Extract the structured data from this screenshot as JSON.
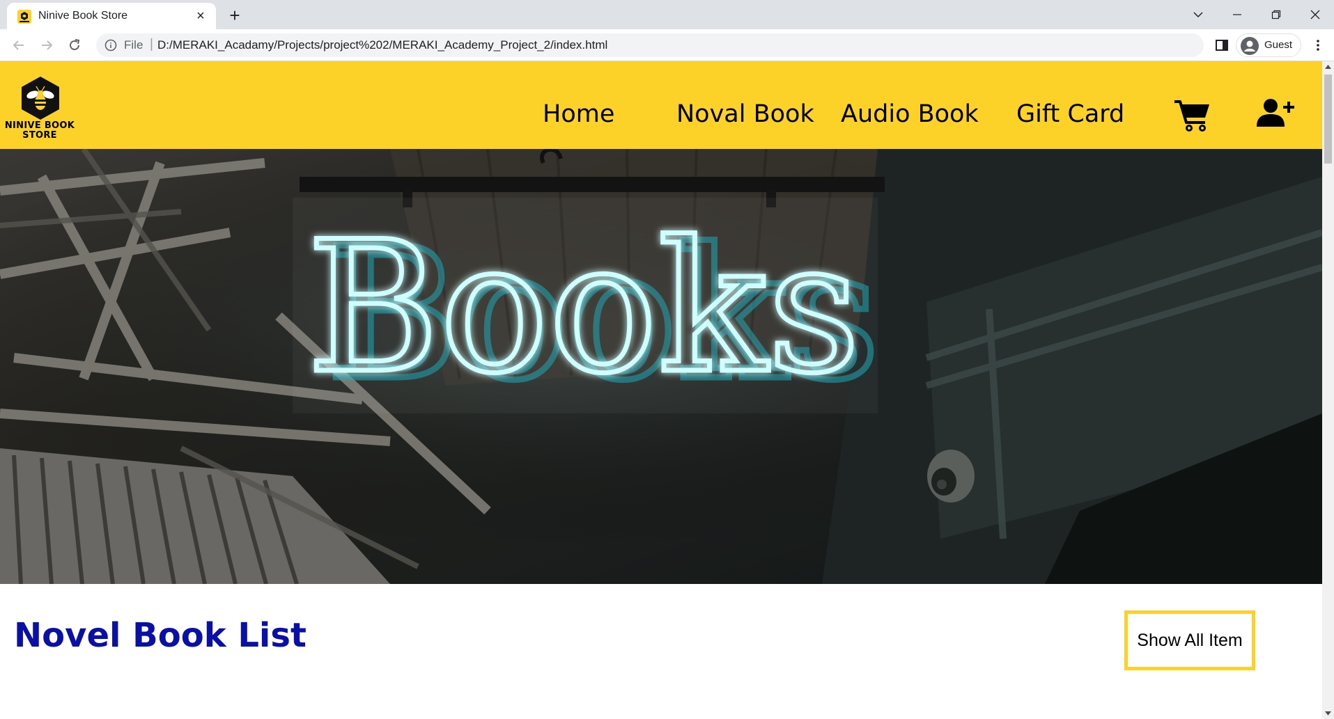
{
  "browser": {
    "tab": {
      "title": "Ninive Book Store",
      "favicon": "bee-favicon",
      "close": "×"
    },
    "new_tab": "+",
    "window_controls": [
      "tab-search",
      "minimize",
      "restore",
      "close"
    ],
    "address_bar": {
      "scheme_label": "File",
      "separator": "|",
      "url": "D:/MERAKI_Acadamy/Projects/project%202/MERAKI_Academy_Project_2/index.html"
    },
    "profile": {
      "label": "Guest"
    }
  },
  "site": {
    "brand": {
      "line1": "NINIVE BOOK",
      "line2": "STORE",
      "colors": {
        "header": "#fcd228"
      }
    },
    "nav": [
      {
        "label": "Home"
      },
      {
        "label": "Noval Book"
      },
      {
        "label": "Audio Book"
      },
      {
        "label": "Gift Card"
      }
    ],
    "icons": {
      "cart": "shopping-cart-icon",
      "account": "user-plus-icon"
    },
    "hero": {
      "sign_text": "Books",
      "sign_color": "#9ef3f6"
    },
    "section": {
      "title": "Novel Book List",
      "title_color": "#0a10a6",
      "button_label": "Show All Item",
      "button_border": "#fcd228"
    }
  }
}
